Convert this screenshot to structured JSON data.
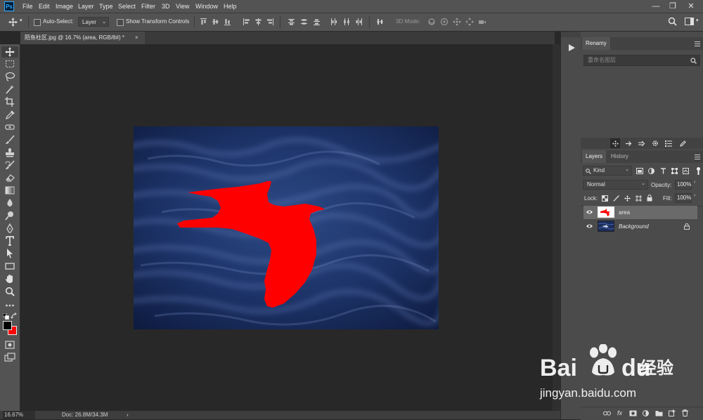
{
  "app": {
    "logo": "Ps"
  },
  "menu": [
    "File",
    "Edit",
    "Image",
    "Layer",
    "Type",
    "Select",
    "Filter",
    "3D",
    "View",
    "Window",
    "Help"
  ],
  "window_controls": {
    "minimize": "—",
    "restore": "❐",
    "close": "✕"
  },
  "options": {
    "auto_select_label": "Auto-Select:",
    "auto_select_target": "Layer",
    "show_transform_label": "Show Transform Controls",
    "mode_3d_label": "3D Mode:"
  },
  "document": {
    "tab_title": "陌鱼杜区.jpg @ 16.7% (area, RGB/8#) *",
    "close_glyph": "×"
  },
  "status": {
    "zoom": "16.67%",
    "doc": "Doc: 26.8M/34.3M",
    "arrow": "›"
  },
  "panels": {
    "renamy": {
      "title": "Renamy",
      "placeholder": "重命名图层"
    },
    "layers_tab": "Layers",
    "history_tab": "History",
    "filter_kind": "Kind",
    "blend_mode": "Normal",
    "opacity_label": "Opacity:",
    "opacity_value": "100%",
    "lock_label": "Lock:",
    "fill_label": "Fill:",
    "fill_value": "100%",
    "layers": [
      {
        "name": "area",
        "selected": true
      },
      {
        "name": "Background",
        "italic": true,
        "locked": true
      }
    ]
  },
  "watermark": {
    "brand": "Bai",
    "brand2": "du",
    "sub": "经验",
    "url": "jingyan.baidu.com"
  },
  "colors": {
    "foreground": "#000000",
    "background": "#ff0000",
    "selection_fill": "#ff0000",
    "sea": "#1a2d5c"
  }
}
